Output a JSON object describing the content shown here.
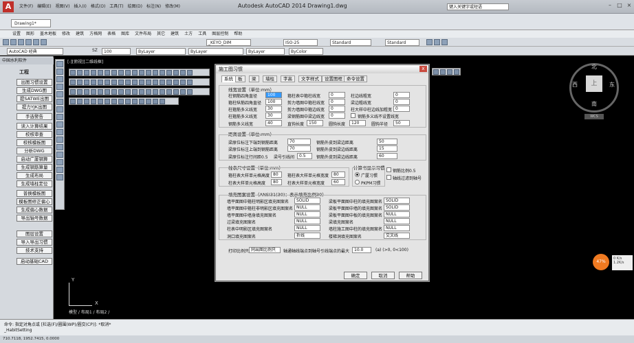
{
  "app": {
    "title": "Autodesk AutoCAD 2014    Drawing1.dwg",
    "quick_access": [
      "文件(F)",
      "编辑(E)",
      "视图(V)",
      "插入(I)",
      "格式(O)",
      "工具(T)",
      "绘图(D)",
      "标注(N)",
      "修改(M)"
    ],
    "doc_tab": "Drawing1*",
    "search_placeholder": "键入关键字或短语"
  },
  "menubar": [
    "设置",
    "图形",
    "盖木地板",
    "修改",
    "建筑",
    "方格网",
    "表格",
    "图库",
    "文件布局",
    "其它",
    "建筑",
    "土方",
    "工具",
    "图层控制",
    "帮助"
  ],
  "toolbar_row1": {
    "workspace": "AutoCAD 经典",
    "layer": "ByLayer",
    "dimstyle": "_KEYO_DIM",
    "textstyle": "ISO-25",
    "plotstyle": "Standard",
    "table_style": "Standard",
    "size_label": "SZ",
    "size_value": "100"
  },
  "toolbar_row2": {
    "color": "ByLayer",
    "linetype": "ByLayer",
    "lineweight": "ByLayer",
    "plot": "ByColor"
  },
  "left_panel": {
    "title": "中国水利软件",
    "heading": "工程",
    "items": [
      "出图习惯设置",
      "生成DWG图",
      "提SATWE出图",
      "提力YJK出图",
      "手选警告",
      "读入计算结果",
      "校核审查",
      "校核模板图",
      "分析DWG",
      "启动广厦钢算",
      "生成钢筋算量",
      "生成布局",
      "生成墙柱定位",
      "普换模板图",
      "模板图修正偏心",
      "生成偏心数据",
      "导出轴号数据",
      "图层设置",
      "导入导出习惯",
      "技术支持",
      "启动基础CAD"
    ]
  },
  "canvas": {
    "viewport_label": "[-][俯视][二维线框]",
    "layout_tabs": "模型 / 布局1 / 布局2 /",
    "ucs_x": "X",
    "ucs_y": "Y"
  },
  "compass": {
    "n": "北",
    "s": "南",
    "e": "东",
    "w": "西",
    "top": "上",
    "wcs": "WCS"
  },
  "net": {
    "percent": "47%",
    "up": "0 K/s",
    "down": "1.2K/s"
  },
  "command": {
    "line1": "命令:  指定对角点或 [栏选(F)/圈围(WP)/圈交(CP)]: *取消*",
    "line2": "_HabitSetting"
  },
  "statusbar": "710.7118, 1952.7415, 0.0000",
  "dialog": {
    "title": "施工图习惯",
    "close": "x",
    "tabs": [
      "系统",
      "板",
      "梁",
      "墙柱",
      "字高",
      "文字样式",
      "设置图框",
      "命令设置"
    ],
    "rebar_section": "线宽设置（单位:mm）",
    "rebar_rows": [
      {
        "l1": "柱钢筋四角直径",
        "v1": "100",
        "l2": "箍柱表中箍柱线宽",
        "v2": "0",
        "l3": "柱边线粗宽",
        "v3": "0"
      },
      {
        "l1": "箍柱纵筋四角直径",
        "v1": "100",
        "l2": "剪力墙图中箍柱线宽",
        "v2": "0",
        "l3": "梁边粗线宽",
        "v3": "0"
      },
      {
        "l1": "柱箍筋多义线宽",
        "v1": "30",
        "l2": "剪力墙图中箍边线宽",
        "v2": "0",
        "l3": "柱大样中柱边线加粗宽",
        "v3": "0"
      },
      {
        "l1": "柱箍筋多义线宽",
        "v1": "30",
        "l2": "梁钢筋图中梁边线宽",
        "v2": "0",
        "l3": "钢筋多义线不设置线宽",
        "v3": ""
      },
      {
        "l1": "钢筋多义线宽",
        "v1": "40",
        "l2": "直钩长度",
        "v2": "150",
        "l3": "圆钩长度",
        "v3": "120",
        "l4": "圆钩半径",
        "v4": "50"
      }
    ],
    "distance_section": "距离设置（单位:mm）",
    "distance_rows": [
      {
        "l1": "梁原位标注下端到钢筋距离",
        "v1": "70",
        "l2": "钢筋外皮到梁边距离",
        "v2": "50"
      },
      {
        "l1": "梁原位标注上端到钢筋距离",
        "v1": "70",
        "l2": "钢筋外皮到梁边线距离",
        "v2": "15"
      },
      {
        "l1": "梁原位标注行间距0.5",
        "v1": "",
        "l2": "梁号引线间",
        "v2": "0.5",
        "l3": "钢筋外皮到梁边线距离",
        "v3": "60"
      }
    ],
    "table_section": "柱表尺寸设置（单位:mm）",
    "table_rows": [
      {
        "l1": "箍柱表大样单元格高度",
        "v1": "80",
        "l2": "箍柱表大样单元格宽度",
        "v2": "80"
      },
      {
        "l1": "柱表大样单元格高度",
        "v1": "80",
        "l2": "柱表大样单元格宽度",
        "v2": "60"
      }
    ],
    "calc_section": "计算书显示习惯",
    "calc_options": [
      "广厦习惯",
      "PKPM习惯"
    ],
    "check1": "钢筋比例0.5",
    "check2": "轴线过滤到轴号",
    "hatch_section": "填充图案设置（ANSI31(30)：表示填充比例30）",
    "hatch_rows": [
      {
        "l1": "墙平面图中箍柱明影区填充图案名",
        "v1": "SOLID",
        "l2": "梁板平面图中柱的填充图案名",
        "v2": "SOLID"
      },
      {
        "l1": "墙平面图中箍柱非明影区填充图案名",
        "v1": "NULL",
        "l2": "梁板平面图中墙的填充图案名",
        "v2": "SOLID"
      },
      {
        "l1": "墙平面图中墙身填充图案名",
        "v1": "NULL",
        "l2": "梁板平面图中板的填充图案名",
        "v2": "NULL"
      },
      {
        "l1": "过梁填充图案名",
        "v1": "NULL",
        "l2": "梁填充图案名",
        "v2": "NULL"
      },
      {
        "l1": "柱表中明影区填充图案名",
        "v1": "NULL",
        "l2": "墙柱施工图中柱的填充图案名",
        "v2": "NULL"
      },
      {
        "l1": "洞口填充图案名",
        "v1": "折线",
        "l2": "楼梯洞填充图案名",
        "v2": "交叉线"
      }
    ],
    "print_label": "打印比例只",
    "print_value": "同出图比例只",
    "axis_label": "轴通轴线端点到轴号引线端点的最大",
    "axis_value": "10.0",
    "axis_hint": "(a) (>0, 0<100)",
    "ok": "确定",
    "cancel": "取消",
    "help": "帮助"
  }
}
